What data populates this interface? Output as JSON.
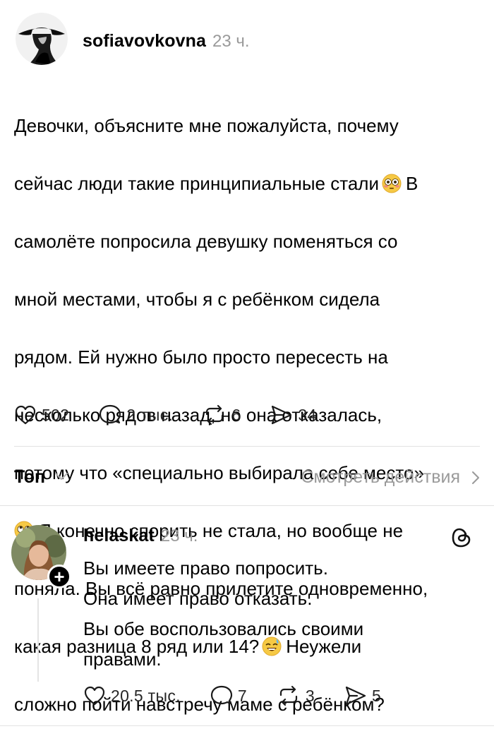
{
  "post": {
    "username": "sofiavovkovna",
    "time": "23 ч.",
    "lines": [
      "Девочки, объясните мне пожалуйста, почему",
      "сейчас люди такие принципиальные стали",
      "самолёте попросила девушку поменяться со",
      "мной местами, чтобы я с ребёнком сидела",
      "рядом. Ей нужно было просто пересесть на",
      "несколько рядов назад, но она отказалась,",
      "потому что «специально выбирала себе место»",
      "Я конечно спорить не стала, но вообще не",
      "поняла. Вы всё равно прилетите одновременно,",
      "какая разница 8 ряд или 14?",
      "сложно пойти навстречу маме с ребёнком?"
    ],
    "after_emoji_1": "В",
    "after_emoji_3": "Неужели",
    "emoji_names": [
      "flushed-face-emoji",
      "eye-roll-emoji",
      "sweat-smile-emoji"
    ],
    "stats": {
      "likes": "502",
      "comments": "2 тыс.",
      "reposts": "6",
      "shares": "34"
    }
  },
  "sort": {
    "label": "Топ",
    "view_activity": "Смотреть действия"
  },
  "comment": {
    "username": "helaskat",
    "time": "23 ч.",
    "lines": [
      "Вы имеете право попросить.",
      "Она имеет право отказать.",
      "Вы обе воспользовались своими",
      "правами."
    ],
    "stats": {
      "likes": "20.5 тыс.",
      "comments": "7",
      "reposts": "3",
      "shares": "5"
    }
  }
}
